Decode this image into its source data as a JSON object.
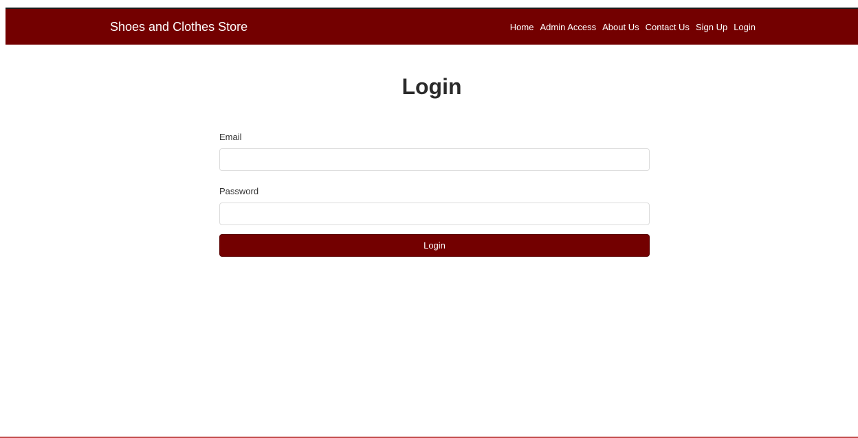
{
  "navbar": {
    "brand": "Shoes and Clothes Store",
    "links": [
      "Home",
      "Admin Access",
      "About Us",
      "Contact Us",
      "Sign Up",
      "Login"
    ]
  },
  "main": {
    "title": "Login",
    "email_label": "Email",
    "email_value": "",
    "password_label": "Password",
    "password_value": "",
    "submit_label": "Login"
  },
  "colors": {
    "brand": "#730000",
    "footer_line": "#c24a4a"
  }
}
